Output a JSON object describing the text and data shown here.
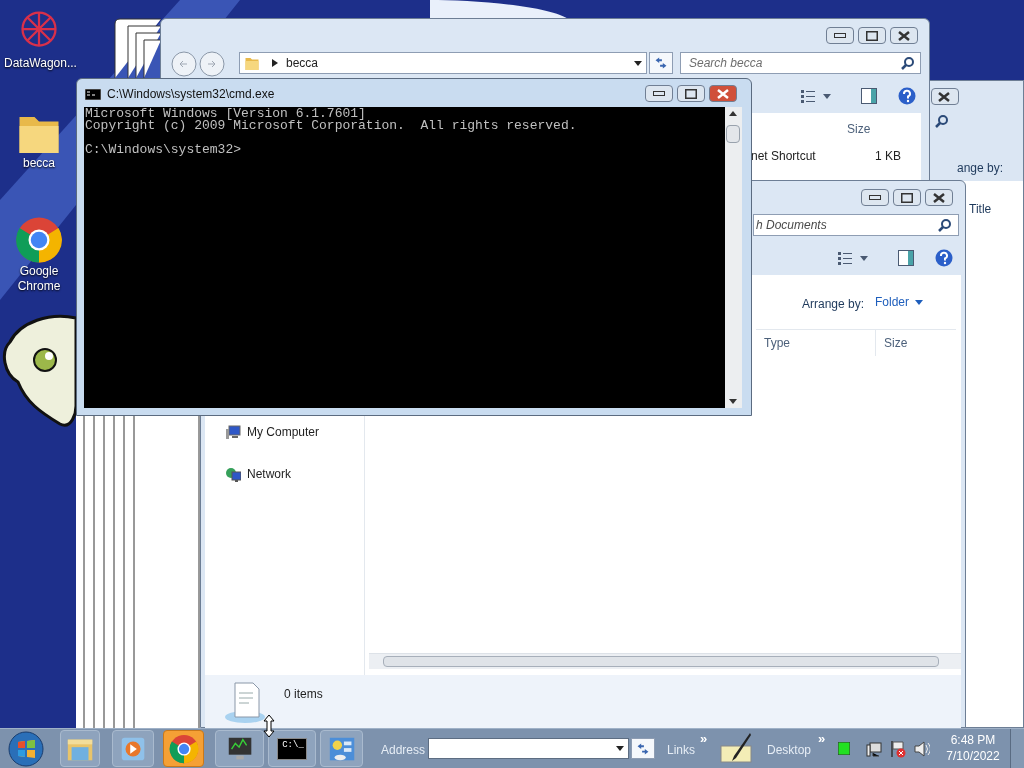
{
  "desktop_icons": [
    {
      "kind": "app",
      "label": "DataWagon..."
    },
    {
      "kind": "folder",
      "label": "becca"
    },
    {
      "kind": "chrome",
      "label": "Google Chrome"
    }
  ],
  "back_window": {
    "arrange_label": "ange by:",
    "column": "Title"
  },
  "becca_window": {
    "address": "becca",
    "search": {
      "placeholder": "Search becca"
    },
    "column": "Size",
    "rows": [
      {
        "type": "net Shortcut",
        "size": "1 KB"
      }
    ]
  },
  "documents_window": {
    "search": {
      "placeholder": "h Documents"
    },
    "arrange_label": "Arrange by:",
    "arrange_value": "Folder",
    "columns": [
      "Type",
      "Size"
    ],
    "nav_items": [
      {
        "kind": "computer",
        "label": "My Computer"
      },
      {
        "kind": "network",
        "label": "Network"
      }
    ],
    "status": "0 items"
  },
  "cmd_window": {
    "title": "C:\\Windows\\system32\\cmd.exe",
    "lines": [
      "Microsoft Windows [Version 6.1.7601]",
      "Copyright (c) 2009 Microsoft Corporation.  All rights reserved."
    ],
    "prompt": "C:\\Windows\\system32>"
  },
  "taskbar": {
    "items": [
      {
        "kind": "explorer",
        "flashing": false
      },
      {
        "kind": "media",
        "flashing": false
      },
      {
        "kind": "chrome",
        "flashing": true
      },
      {
        "kind": "monitor",
        "flashing": false
      },
      {
        "kind": "cmd",
        "flashing": false
      },
      {
        "kind": "panel",
        "flashing": false
      }
    ],
    "cmd_label": "C:\\_",
    "address_label": "Address",
    "links_label": "Links",
    "links_chevron": "»",
    "desktop_label": "Desktop",
    "desktop_chevron": "»",
    "time": "6:48 PM",
    "date": "7/10/2022"
  }
}
